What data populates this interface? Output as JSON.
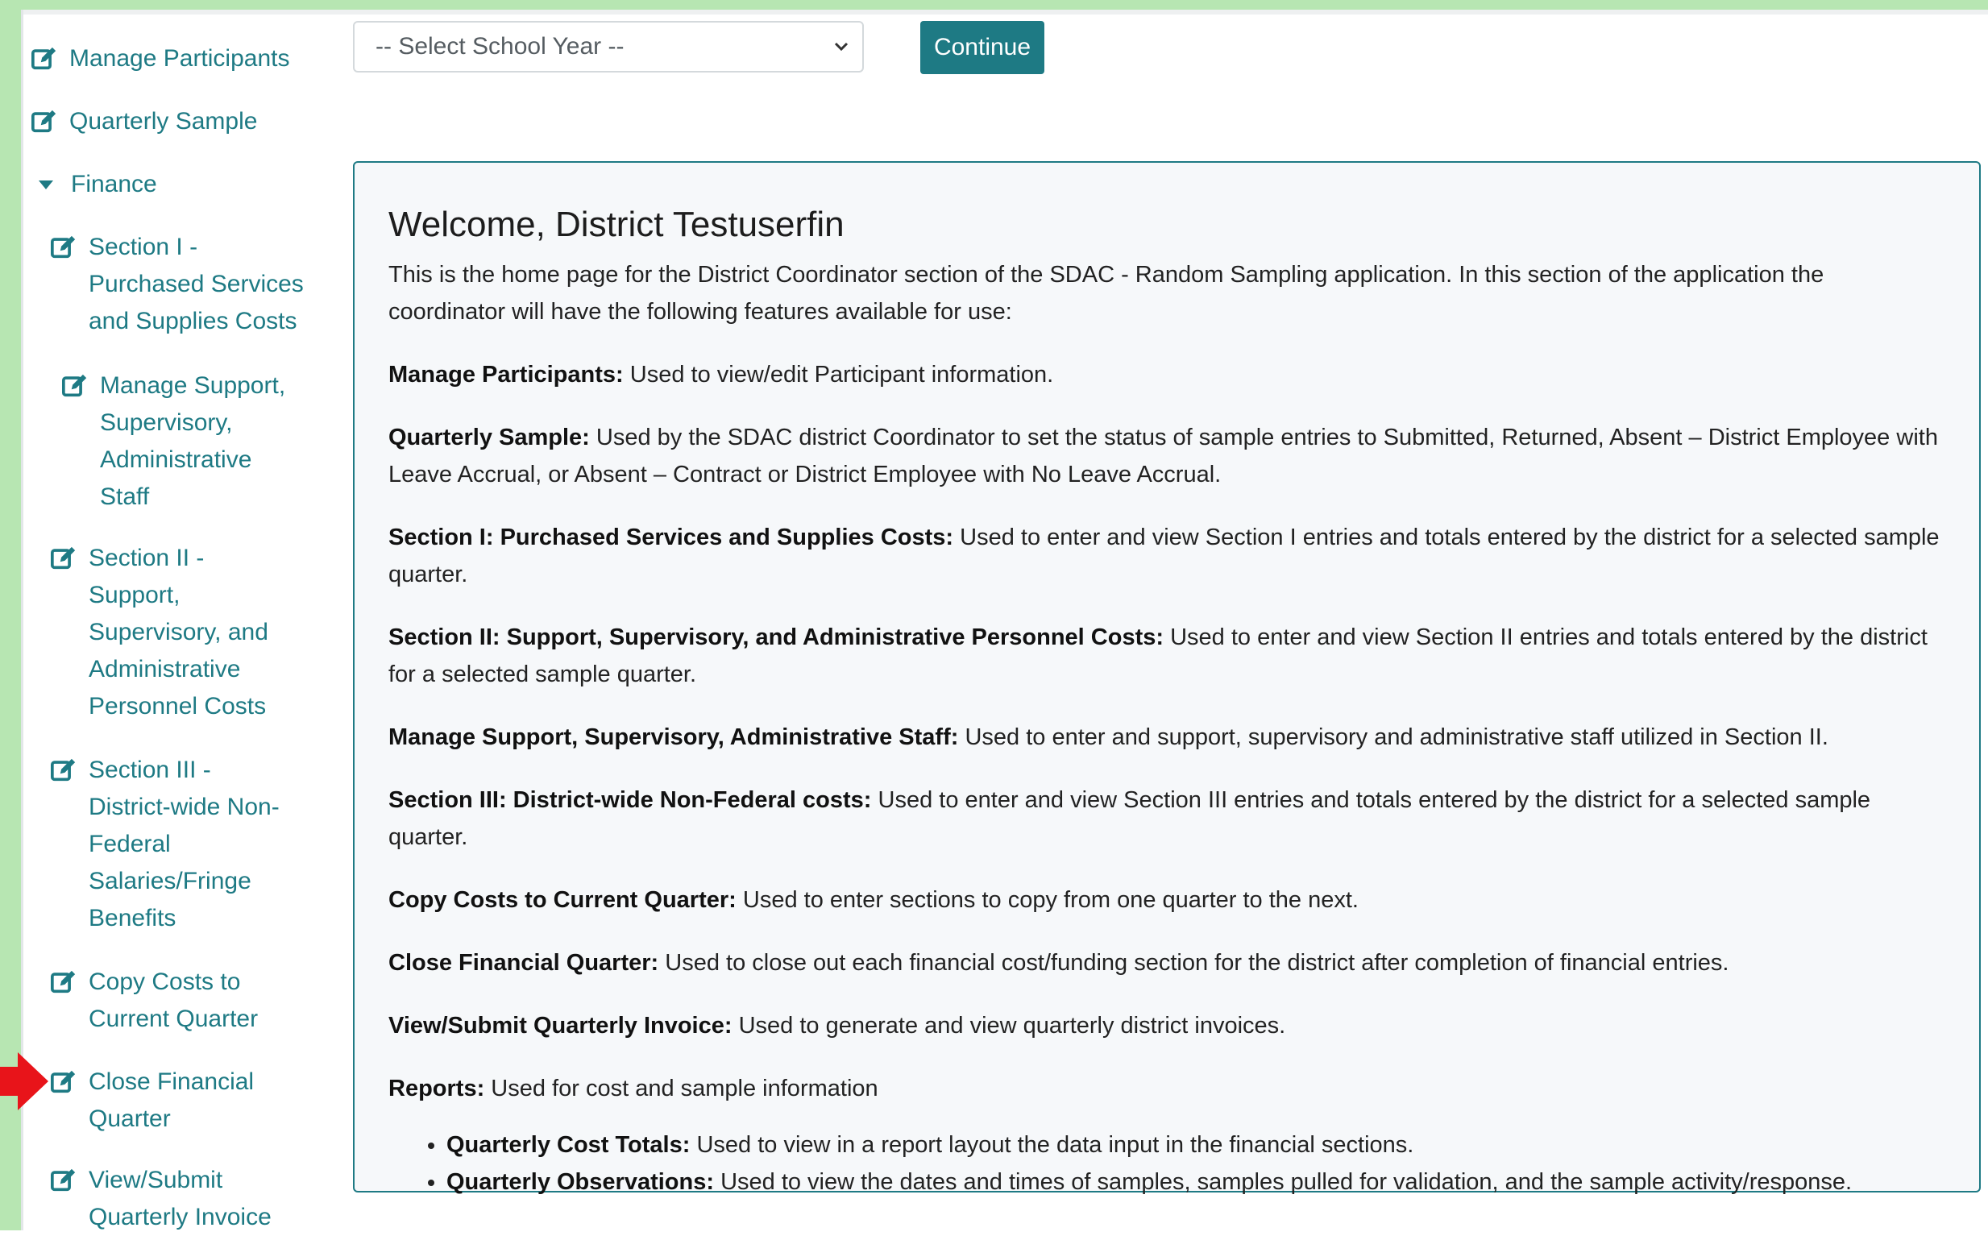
{
  "sidebar": {
    "items": [
      {
        "label_lines": [
          "Manage Participants"
        ]
      },
      {
        "label_lines": [
          "Quarterly Sample"
        ]
      },
      {
        "label_lines": [
          "Finance"
        ]
      },
      {
        "label_lines": [
          "Section I -",
          "Purchased Services",
          "and Supplies Costs"
        ]
      },
      {
        "label_lines": [
          "Manage Support,",
          "Supervisory,",
          "Administrative",
          "Staff"
        ]
      },
      {
        "label_lines": [
          "Section II -",
          "Support,",
          "Supervisory, and",
          "Administrative",
          "Personnel Costs"
        ]
      },
      {
        "label_lines": [
          "Section III -",
          "District-wide Non-",
          "Federal",
          "Salaries/Fringe",
          "Benefits"
        ]
      },
      {
        "label_lines": [
          "Copy Costs to",
          "Current Quarter"
        ]
      },
      {
        "label_lines": [
          "Close Financial",
          "Quarter"
        ]
      },
      {
        "label_lines": [
          "View/Submit",
          "Quarterly Invoice"
        ]
      }
    ]
  },
  "toolbar": {
    "school_year_select": "-- Select School Year --",
    "continue_label": "Continue"
  },
  "welcome": {
    "title": "Welcome, District Testuserfin",
    "intro": "This is the home page for the District Coordinator section of the SDAC - Random Sampling application. In this section of the application the coordinator will have the following features available for use:",
    "features": [
      {
        "term": "Manage Participants:",
        "desc": "Used to view/edit Participant information."
      },
      {
        "term": "Quarterly Sample:",
        "desc": "Used by the SDAC district Coordinator to set the status of sample entries to Submitted, Returned, Absent – District Employee with Leave Accrual, or Absent – Contract or District Employee with No Leave Accrual."
      },
      {
        "term": "Section I: Purchased Services and Supplies Costs:",
        "desc": "Used to enter and view Section I entries and totals entered by the district for a selected sample quarter."
      },
      {
        "term": "Section II: Support, Supervisory, and Administrative Personnel Costs:",
        "desc": "Used to enter and view Section II entries and totals entered by the district for a selected sample quarter."
      },
      {
        "term": "Manage Support, Supervisory, Administrative Staff:",
        "desc": "Used to enter and support, supervisory and administrative staff utilized in Section II."
      },
      {
        "term": "Section III: District-wide Non-Federal costs:",
        "desc": "Used to enter and view Section III entries and totals entered by the district for a selected sample quarter."
      },
      {
        "term": "Copy Costs to Current Quarter:",
        "desc": "Used to enter sections to copy from one quarter to the next."
      },
      {
        "term": "Close Financial Quarter:",
        "desc": "Used to close out each financial cost/funding section for the district after completion of financial entries."
      },
      {
        "term": "View/Submit Quarterly Invoice:",
        "desc": "Used to generate and view quarterly district invoices."
      },
      {
        "term": "Reports:",
        "desc": "Used for cost and sample information"
      }
    ],
    "reports": [
      {
        "term": "Quarterly Cost Totals:",
        "desc": "Used to view in a report layout the data input in the financial sections."
      },
      {
        "term": "Quarterly Observations:",
        "desc": "Used to view the dates and times of samples, samples pulled for validation, and the sample activity/response."
      }
    ]
  },
  "colors": {
    "accent": "#1e7a84",
    "frame": "#b7e6b2",
    "arrow": "#e8141a"
  }
}
